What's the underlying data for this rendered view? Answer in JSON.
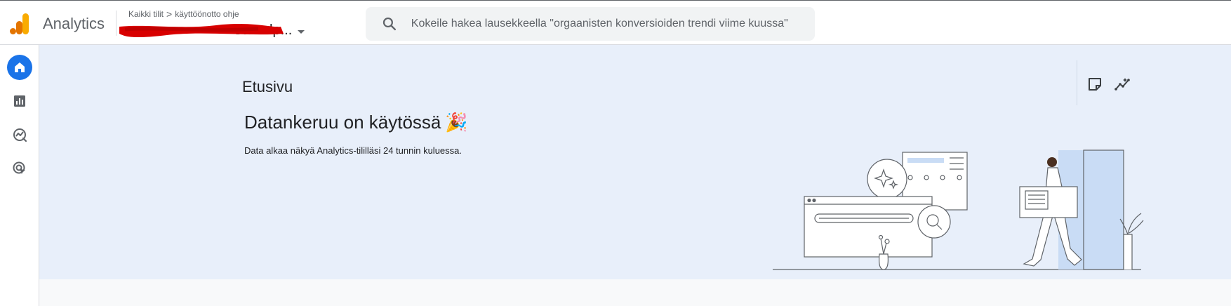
{
  "header": {
    "app_title": "Analytics",
    "breadcrumb": {
      "account": "Kaikki tilit",
      "separator": ">",
      "property": "käyttöönotto ohje"
    },
    "property_name": "t/wordp...",
    "search": {
      "placeholder": "Kokeile hakea lausekkeella \"orgaanisten konversioiden trendi viime kuussa\""
    }
  },
  "nav": {
    "items": [
      {
        "name": "home",
        "icon": "home-icon",
        "active": true
      },
      {
        "name": "reports",
        "icon": "bar-chart-icon",
        "active": false
      },
      {
        "name": "explore",
        "icon": "explore-icon",
        "active": false
      },
      {
        "name": "advertising",
        "icon": "advertising-icon",
        "active": false
      }
    ]
  },
  "main": {
    "page_title": "Etusivu",
    "headline": "Datankeruu on käytössä",
    "headline_emoji": "🎉",
    "subtext": "Data alkaa näkyä Analytics-tililläsi 24 tunnin kuluessa.",
    "tools": [
      {
        "name": "notes",
        "icon": "note-icon"
      },
      {
        "name": "insights",
        "icon": "insights-icon"
      }
    ]
  },
  "colors": {
    "accent": "#1a73e8",
    "hero_bg": "#e8effa",
    "logo_orange_dark": "#e37400",
    "logo_orange_light": "#f9ab00",
    "redaction": "#d80000"
  }
}
